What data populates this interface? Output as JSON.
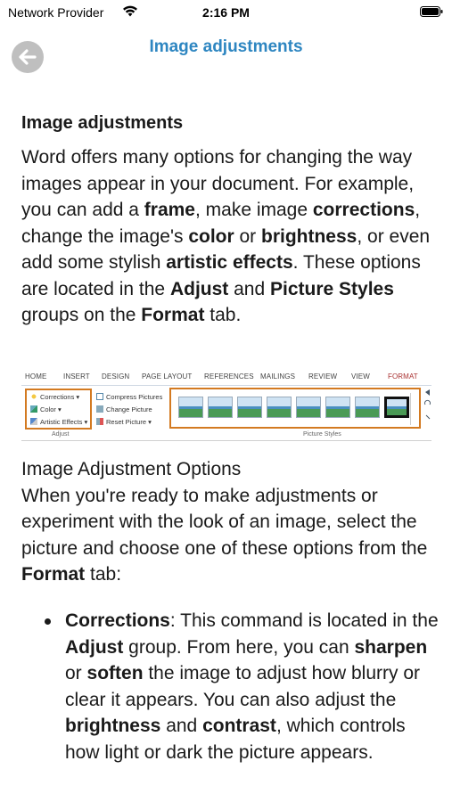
{
  "status_bar": {
    "carrier": "Network Provider",
    "time": "2:16 PM"
  },
  "nav": {
    "title": "Image adjustments"
  },
  "section": {
    "heading": "Image adjustments",
    "intro": [
      {
        "t": "Word offers many options for changing the way images appear in your document. For example, you can add a ",
        "b": false
      },
      {
        "t": "frame",
        "b": true
      },
      {
        "t": ", make image ",
        "b": false
      },
      {
        "t": "corrections",
        "b": true
      },
      {
        "t": ", change the image's ",
        "b": false
      },
      {
        "t": "color",
        "b": true
      },
      {
        "t": " or ",
        "b": false
      },
      {
        "t": "brightness",
        "b": true
      },
      {
        "t": ", or even add some stylish ",
        "b": false
      },
      {
        "t": "artistic effects",
        "b": true
      },
      {
        "t": ". These options are located in the ",
        "b": false
      },
      {
        "t": "Adjust",
        "b": true
      },
      {
        "t": " and ",
        "b": false
      },
      {
        "t": "Picture Styles",
        "b": true
      },
      {
        "t": " groups on the ",
        "b": false
      },
      {
        "t": "Format",
        "b": true
      },
      {
        "t": " tab.",
        "b": false
      }
    ]
  },
  "ribbon": {
    "tabs": [
      "HOME",
      "INSERT",
      "DESIGN",
      "PAGE LAYOUT",
      "REFERENCES",
      "MAILINGS",
      "REVIEW",
      "VIEW",
      "FORMAT"
    ],
    "adjust_items": [
      "Corrections ▾",
      "Color ▾",
      "Artistic Effects ▾"
    ],
    "mid_items": [
      "Compress Pictures",
      "Change Picture",
      "Reset Picture ▾"
    ],
    "adjust_label": "Adjust",
    "styles_label": "Picture Styles"
  },
  "options": {
    "heading": "Image Adjustment Options",
    "intro": [
      {
        "t": "When you're ready to make adjustments or experiment with the look of an image, select the picture and choose one of these options from the ",
        "b": false
      },
      {
        "t": "Format",
        "b": true
      },
      {
        "t": " tab:",
        "b": false
      }
    ],
    "bullets": [
      [
        {
          "t": "Corrections",
          "b": true
        },
        {
          "t": ": This command is located in the ",
          "b": false
        },
        {
          "t": "Adjust",
          "b": true
        },
        {
          "t": " group. From here, you can ",
          "b": false
        },
        {
          "t": "sharpen",
          "b": true
        },
        {
          "t": " or ",
          "b": false
        },
        {
          "t": "soften",
          "b": true
        },
        {
          "t": " the image to adjust how blurry or clear it appears. You can also adjust the ",
          "b": false
        },
        {
          "t": "brightness",
          "b": true
        },
        {
          "t": " and ",
          "b": false
        },
        {
          "t": "contrast",
          "b": true
        },
        {
          "t": ", which controls how light or dark the picture appears.",
          "b": false
        }
      ]
    ]
  }
}
